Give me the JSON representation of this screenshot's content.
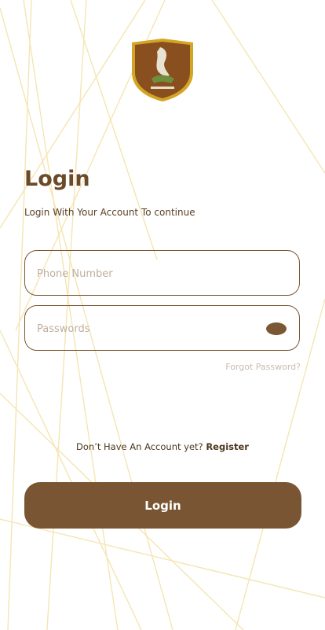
{
  "title": "Login",
  "subtitle": "Login With Your Account To continue",
  "phone_input": {
    "placeholder": "Phone Number"
  },
  "password_input": {
    "placeholder": "Passwords"
  },
  "forgot_password": "Forgot Password?",
  "register_prompt": {
    "text": "Don’t Have An Account yet?",
    "link": "Register"
  },
  "login_button": "Login",
  "icons": {
    "logo": "crest-logo",
    "password_toggle": "eye-icon"
  },
  "colors": {
    "brand": "#7a5533",
    "accent_lines": "#f3e2a9",
    "field_border": "#7b5733",
    "placeholder": "#bfaf9f"
  }
}
